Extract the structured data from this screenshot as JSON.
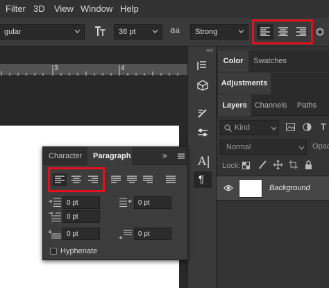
{
  "menu": {
    "items": [
      "Filter",
      "3D",
      "View",
      "Window",
      "Help"
    ]
  },
  "options_bar": {
    "font_style": "gular",
    "font_size": "36 pt",
    "antialias_label": "a",
    "antialias_sub": "a",
    "antialias_value": "Strong",
    "align_left": "align-left-icon",
    "align_center": "align-center-icon",
    "align_right": "align-right-icon"
  },
  "ruler": {
    "marks": [
      "3",
      "4"
    ]
  },
  "panel_collapse": "««",
  "right_panel": {
    "tabs_top": [
      "Color",
      "Swatches"
    ],
    "adjustments": "Adjustments",
    "tabs_layers": [
      "Layers",
      "Channels",
      "Paths"
    ],
    "kind_label": "Kind",
    "blend_mode": "Normal",
    "opacity_label": "Opaci",
    "lock_label": "Lock:",
    "layer_name": "Background"
  },
  "paragraph_panel": {
    "tabs": [
      "Character",
      "Paragraph"
    ],
    "collapse": "»",
    "indent_left": "0 pt",
    "indent_right": "0 pt",
    "indent_first": "0 pt",
    "space_before": "0 pt",
    "space_after": "0 pt",
    "hyphenate": "Hyphenate"
  },
  "highlight_color": "#e2111d"
}
